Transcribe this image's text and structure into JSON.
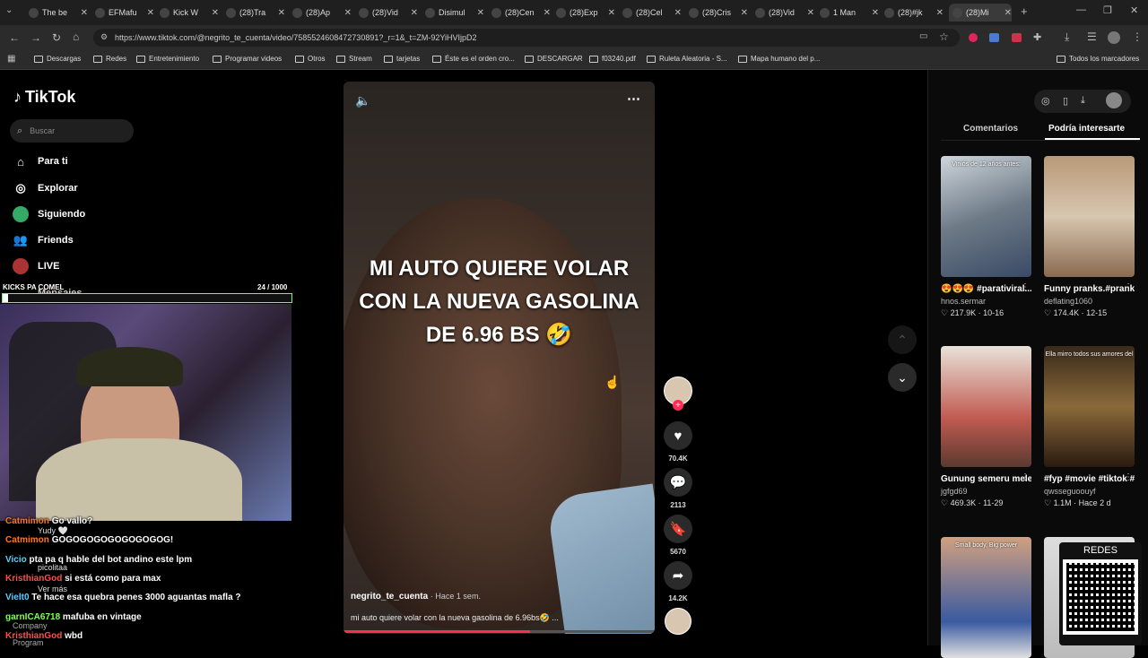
{
  "tabs": [
    {
      "label": "The be"
    },
    {
      "label": "EFMafu"
    },
    {
      "label": "Kick W"
    },
    {
      "label": "(28)Tra"
    },
    {
      "label": "(28)Ap"
    },
    {
      "label": "(28)Vid"
    },
    {
      "label": "Disimul"
    },
    {
      "label": "(28)Cen"
    },
    {
      "label": "(28)Exp"
    },
    {
      "label": "(28)Cel"
    },
    {
      "label": "(28)Cris"
    },
    {
      "label": "(28)Vid"
    },
    {
      "label": "1 Man"
    },
    {
      "label": "(28)#jk"
    },
    {
      "label": "(28)Mi"
    }
  ],
  "url": "https://www.tiktok.com/@negrito_te_cuenta/video/7585524608472730891?_r=1&_t=ZM-92YiHVIjpD2",
  "bookmarks": [
    {
      "label": "Descargas"
    },
    {
      "label": "Redes"
    },
    {
      "label": "Entretenimiento"
    },
    {
      "label": "Programar videos"
    },
    {
      "label": "Otros"
    },
    {
      "label": "Stream"
    },
    {
      "label": "tarjetas"
    },
    {
      "label": "Éste es el orden cro..."
    },
    {
      "label": "DESCARGAR"
    },
    {
      "label": "f03240.pdf"
    },
    {
      "label": "Ruleta Aleatoria - S..."
    },
    {
      "label": "Mapa humano del p..."
    },
    {
      "label": "Todos los marcadores"
    }
  ],
  "logo": "TikTok",
  "search_placeholder": "Buscar",
  "nav": {
    "for_you": "Para ti",
    "explore": "Explorar",
    "following": "Siguiendo",
    "friends": "Friends",
    "live": "LIVE",
    "messages": "Mensajes",
    "see_more": "Ver más",
    "company": "Company",
    "program": "Program"
  },
  "overlay": {
    "goal": "KICKS PA COMEL",
    "goal_count": "24  / 1000"
  },
  "video": {
    "caption_lines": [
      "MI AUTO QUIERE VOLAR",
      "CON LA NUEVA GASOLINA",
      "DE 6.96 BS 🤣"
    ],
    "author": "negrito_te_cuenta",
    "time": "· Hace 1 sem.",
    "description": "mi auto quiere volar con la nueva gasolina de 6.96bs🤣 ...",
    "likes": "70.4K",
    "comments": "2113",
    "saves": "5670",
    "shares": "14.2K"
  },
  "panel_tabs": {
    "comments": "Comentarios",
    "suggested": "Podría interesarte"
  },
  "cards": [
    {
      "title": "😍😍😍 #parativiral...",
      "user": "hnos.sermar",
      "stats": "♡ 217.9K · 10-16",
      "thumb_text": "Viniós de 12 años antes:"
    },
    {
      "title": "Funny pranks.#prank...",
      "user": "deflating1060",
      "stats": "♡ 174.4K · 12-15",
      "thumb_text": ""
    },
    {
      "title": "Gunung semeru meletus lagi pad...",
      "user": "jgfgd69",
      "stats": "♡ 469.3K · 11-29",
      "thumb_text": ""
    },
    {
      "title": "#fyp #movie #tiktok #foryou...",
      "user": "qwsseguoouyf",
      "stats": "♡ 1.1M · Hace 2 d",
      "thumb_text": "Ella mirro todos sus amores del"
    },
    {
      "title": "",
      "user": "",
      "stats": "",
      "thumb_text": "Small body, Big power"
    },
    {
      "title": "",
      "user": "",
      "stats": "",
      "thumb_text": ""
    }
  ],
  "qr_label": "REDES",
  "chat": [
    {
      "user": "Catmimon",
      "msg": "Go vallo?",
      "color": "#ff7a1a"
    },
    {
      "user": "Catmimon",
      "msg": "GOGOGOGOGOGOGOGOG!",
      "color": "#ff7a1a"
    },
    {
      "user": "Vicio",
      "msg": "pta pa q hable del bot andino este lpm",
      "color": "#5ad1ff"
    },
    {
      "user": "KristhianGod",
      "msg": "si está como para max",
      "color": "#ff4d4d"
    },
    {
      "user": "Vielt0",
      "msg": "Te hace esa quebra penes 3000 aguantas mafla ?",
      "color": "#5ad1ff"
    },
    {
      "user": "garnICA6718",
      "msg": "mafuba en vintage",
      "color": "#7dff5a"
    },
    {
      "user": "KristhianGod",
      "msg": "wbd",
      "color": "#ff4d4d"
    }
  ],
  "chat_extra": {
    "yudy": "Yudy 🤍",
    "picolitaa": "picolitaa"
  }
}
